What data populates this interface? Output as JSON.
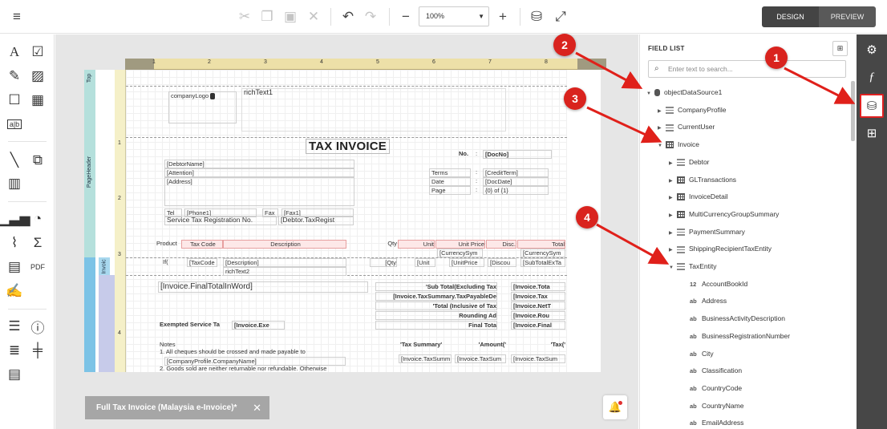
{
  "toolbar": {
    "zoom": "100%",
    "design_label": "DESIGN",
    "preview_label": "PREVIEW"
  },
  "report": {
    "bands": {
      "top": "Top",
      "page_header": "PageHeader",
      "invoice": "Invoic"
    },
    "ruler_top": [
      "1",
      "2",
      "3",
      "4",
      "5",
      "6",
      "7",
      "8"
    ],
    "ruler_left": [
      "1",
      "2",
      "3",
      "4"
    ],
    "fields": {
      "company_logo": "companyLogo",
      "rich_text1": "richText1",
      "title": "TAX INVOICE",
      "no_label": "No.",
      "colon": ":",
      "doc_no": "[DocNo]",
      "debtor_name": "[DebtorName]",
      "attention": "[Attention]",
      "address": "[Address]",
      "terms_label": "Terms",
      "credit_term": "[CreditTerm]",
      "date_label": "Date",
      "doc_date": "[DocDate]",
      "page_label": "Page",
      "page_of": "{0} of {1}",
      "tel_label": "Tel",
      "phone1": "[Phone1]",
      "fax_label": "Fax",
      "fax1": "[Fax1]",
      "sst_label": "Service Tax Registration No.",
      "sst_value": "[Debtor.TaxRegist",
      "h_product": "Product",
      "h_taxcode": "Tax Code",
      "h_description": "Description",
      "h_qty": "Qty",
      "h_unit": "Unit",
      "h_unitprice": "Unit Price",
      "h_disc": "Disc.",
      "h_total": "Total",
      "currency_sym1": "[CurrencySym",
      "currency_sym2": "[CurrencySym",
      "d_if": "If(",
      "d_taxcode": "[TaxCode",
      "d_description": "[Description]",
      "d_qty": "[Qty",
      "d_unit": "[Unit",
      "d_unitprice": "[UnitPrice",
      "d_discount": "[Discou",
      "d_subtotal": "[SubTotalExTa",
      "rich_text2": "richText2",
      "final_total_word": "[Invoice.FinalTotalInWord]",
      "sub_total_label": "'Sub Total(Excluding Tax",
      "sub_total_val": "[Invoice.Tota",
      "tax_payable_label": "[Invoice.TaxSummary.TaxPayableDe",
      "tax_payable_val": "[Invoice.Tax",
      "total_incl_label": "'Total (Inclusive of Tax",
      "total_incl_val": "[Invoice.NetT",
      "rounding_label": "Rounding Ad",
      "rounding_val": "[Invoice.Rou",
      "final_total_label": "Final Tota",
      "final_total_val": "[Invoice.Final",
      "exempted_label": "Exempted Service Ta",
      "exempted_val": "[Invoice.Exe",
      "notes_label": "Notes",
      "note1": "1. All cheques should be crossed and made payable to",
      "company_name": "[CompanyProfile.CompanyName]",
      "note2": "2. Goods sold are neither returnable nor refundable. Otherwise",
      "tax_summary_label": "'Tax Summary'",
      "amount_label": "'Amount('",
      "tax_label": "'Tax('",
      "ts_cell1": "[Invoice.TaxSumm",
      "ts_cell2": "[Invoice.TaxSum",
      "ts_cell3": "[Invoice.TaxSum"
    }
  },
  "doc_tab": {
    "label": "Full Tax Invoice (Malaysia e-Invoice)*"
  },
  "field_list": {
    "title": "FIELD LIST",
    "search_placeholder": "Enter text to search...",
    "nodes": [
      {
        "label": "objectDataSource1",
        "icon": "database-icon",
        "toggle": "▼"
      },
      {
        "label": "CompanyProfile",
        "icon": "datatable-icon",
        "toggle": "▶"
      },
      {
        "label": "CurrentUser",
        "icon": "datatable-icon",
        "toggle": "▶"
      },
      {
        "label": "Invoice",
        "icon": "table-icon",
        "toggle": "▼"
      },
      {
        "label": "Debtor",
        "icon": "datatable-icon",
        "toggle": "▶"
      },
      {
        "label": "GLTransactions",
        "icon": "table-icon",
        "toggle": "▶"
      },
      {
        "label": "InvoiceDetail",
        "icon": "table-icon",
        "toggle": "▶"
      },
      {
        "label": "MultiCurrencyGroupSummary",
        "icon": "table-icon",
        "toggle": "▶"
      },
      {
        "label": "PaymentSummary",
        "icon": "datatable-icon",
        "toggle": "▶"
      },
      {
        "label": "ShippingRecipientTaxEntity",
        "icon": "datatable-icon",
        "toggle": "▶"
      },
      {
        "label": "TaxEntity",
        "icon": "datatable-icon",
        "toggle": "▼"
      },
      {
        "label": "AccountBookId",
        "type": "12"
      },
      {
        "label": "Address",
        "type": "ab"
      },
      {
        "label": "BusinessActivityDescription",
        "type": "ab"
      },
      {
        "label": "BusinessRegistrationNumber",
        "type": "ab"
      },
      {
        "label": "City",
        "type": "ab"
      },
      {
        "label": "Classification",
        "type": "ab"
      },
      {
        "label": "CountryCode",
        "type": "ab"
      },
      {
        "label": "CountryName",
        "type": "ab"
      },
      {
        "label": "EmailAddress",
        "type": "ab"
      }
    ]
  },
  "callouts": [
    "1",
    "2",
    "3",
    "4"
  ],
  "colors": {
    "callout": "#d9231e",
    "dark_panel": "#474747",
    "band_header": "#b5e0dc",
    "band_detail": "#7cc3e6"
  }
}
